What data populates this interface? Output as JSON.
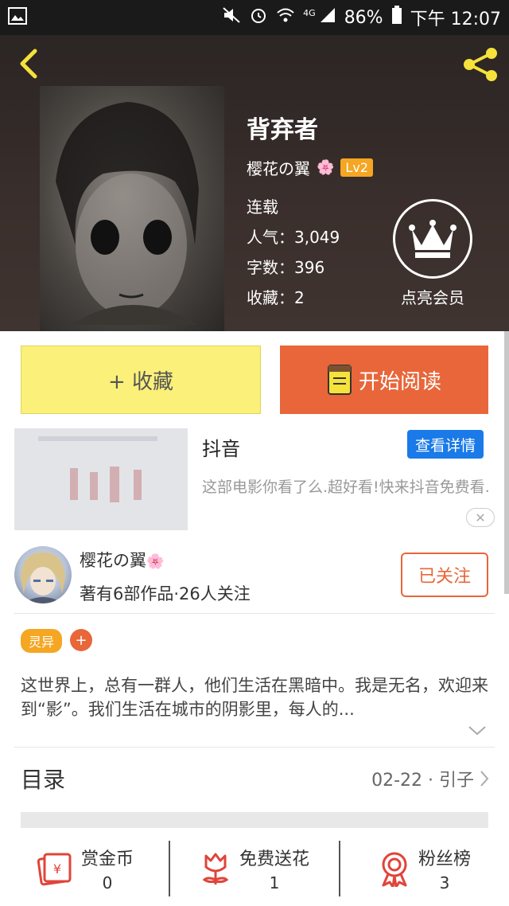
{
  "status": {
    "battery": "86%",
    "time": "下午 12:07",
    "network": "4G"
  },
  "hero": {
    "title": "背弃者",
    "author": "樱花の翼",
    "author_emoji": "🌸",
    "level": "Lv2",
    "status": "连载",
    "popularity": "人气：3,049",
    "word_count": "字数：396",
    "favorites": "收藏：2",
    "vip_label": "点亮会员"
  },
  "actions": {
    "favorite": "+ 收藏",
    "read": "开始阅读"
  },
  "ad": {
    "title": "抖音",
    "button": "查看详情",
    "desc": "这部电影你看了么.超好看!快来抖音免费看.",
    "close": "✕"
  },
  "author_card": {
    "name": "樱花の翼",
    "emoji": "🌸",
    "sub": "著有6部作品·26人关注",
    "follow": "已关注"
  },
  "tags": {
    "genre": "灵异",
    "add": "+"
  },
  "synopsis": "这世界上，总有一群人，他们生活在黑暗中。我是无名，欢迎来到“影”。我们生活在城市的阴影里，每人的...",
  "toc": {
    "title": "目录",
    "latest": "02-22 · 引子"
  },
  "bottom": [
    {
      "label": "赏金币",
      "value": "0"
    },
    {
      "label": "免费送花",
      "value": "1"
    },
    {
      "label": "粉丝榜",
      "value": "3"
    }
  ],
  "colors": {
    "accent": "#e8663a",
    "yellow": "#faf07a",
    "level": "#f5a623",
    "ad_button": "#1a7ae8"
  }
}
